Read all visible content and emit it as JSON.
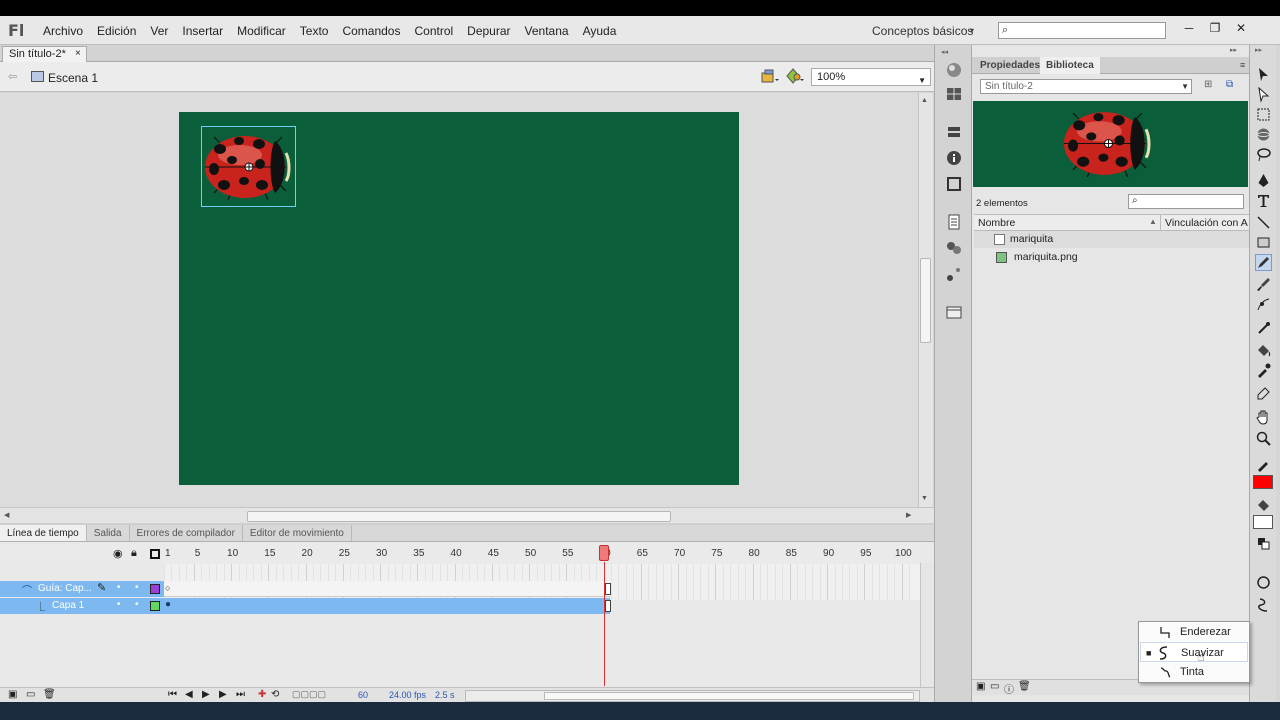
{
  "app": {
    "logo": "Fl"
  },
  "menu": [
    "Archivo",
    "Edición",
    "Ver",
    "Insertar",
    "Modificar",
    "Texto",
    "Comandos",
    "Control",
    "Depurar",
    "Ventana",
    "Ayuda"
  ],
  "workspace": {
    "label": "Conceptos básicos",
    "caret": "▾"
  },
  "window_controls": [
    "─",
    "❐",
    "✕"
  ],
  "document": {
    "tab": "Sin título-2*",
    "close": "×"
  },
  "scene": {
    "label": "Escena 1"
  },
  "zoom": {
    "value": "100%"
  },
  "timeline": {
    "tabs": [
      "Línea de tiempo",
      "Salida",
      "Errores de compilador",
      "Editor de movimiento"
    ],
    "ruler": [
      "1",
      "5",
      "10",
      "15",
      "20",
      "25",
      "30",
      "35",
      "40",
      "45",
      "50",
      "55",
      "60",
      "65",
      "70",
      "75",
      "80",
      "85",
      "90",
      "95",
      "100"
    ],
    "layers": [
      {
        "name": "Guía: Cap..."
      },
      {
        "name": "Capa 1"
      }
    ],
    "playhead_frame": 60,
    "status": {
      "frame": "60",
      "fps": "24.00 fps",
      "time": "2.5 s"
    }
  },
  "library": {
    "tabs": [
      "Propiedades",
      "Biblioteca"
    ],
    "document": "Sin título-2",
    "count": "2 elementos",
    "columns": [
      "Nombre",
      "Vinculación con A"
    ],
    "items": [
      {
        "name": "mariquita",
        "icon": "movieclip-icon"
      },
      {
        "name": "mariquita.png",
        "icon": "bitmap-icon"
      }
    ]
  },
  "popup": {
    "items": [
      {
        "label": "Enderezar",
        "selected": false
      },
      {
        "label": "Suavizar",
        "selected": true
      },
      {
        "label": "Tinta",
        "selected": false
      }
    ]
  },
  "colors": {
    "stage": "#0a5e3a",
    "stroke": "#ff0000",
    "fill": "#ffffff",
    "selection": "#7db9f0",
    "playhead": "#e03030"
  }
}
